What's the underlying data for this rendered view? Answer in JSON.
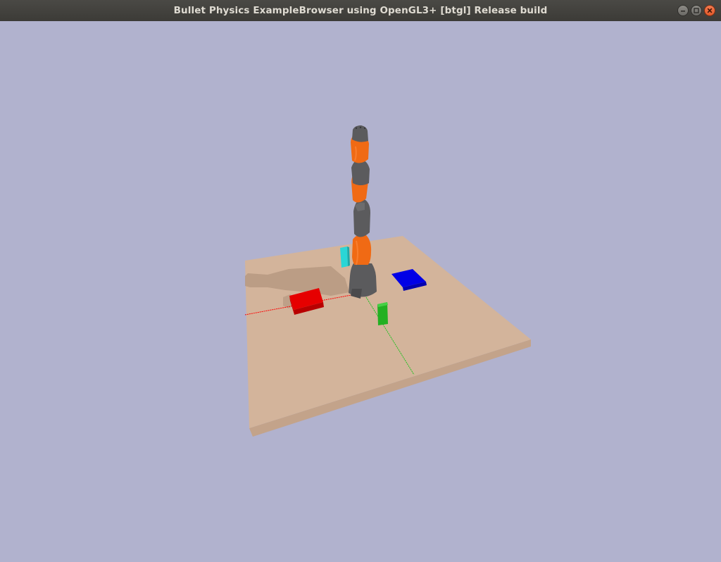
{
  "window": {
    "title": "Bullet Physics ExampleBrowser using OpenGL3+ [btgl] Release build"
  },
  "controls": [
    "minimize-icon",
    "maximize-icon",
    "close-icon"
  ],
  "scene": {
    "background_color": "#b1b2ce",
    "table_color": "#d3b49b",
    "objects": [
      {
        "name": "kuka-robot-arm",
        "colors": [
          "#5b5b5d",
          "#f06a14"
        ]
      },
      {
        "name": "red-block",
        "color": "#e60000"
      },
      {
        "name": "blue-block",
        "color": "#0000e6"
      },
      {
        "name": "green-block",
        "color": "#22b022"
      },
      {
        "name": "cyan-block",
        "color": "#2ad6d6"
      }
    ],
    "axes": [
      {
        "name": "x-axis",
        "color": "#ff0000"
      },
      {
        "name": "y-axis",
        "color": "#22c022"
      }
    ]
  }
}
